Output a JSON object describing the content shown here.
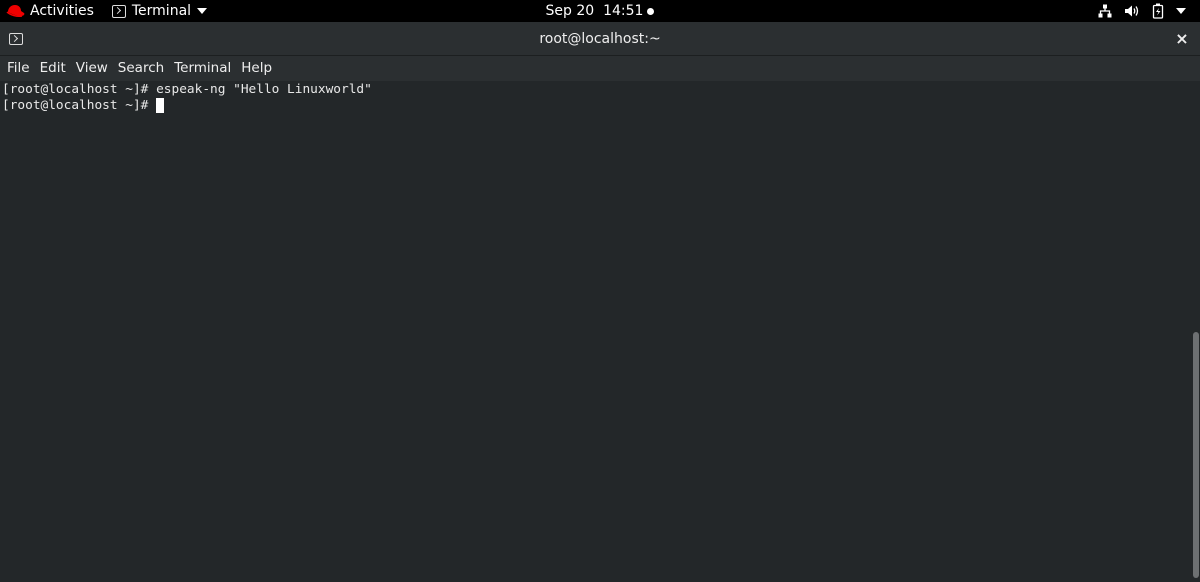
{
  "topbar": {
    "activities": "Activities",
    "app_menu": "Terminal",
    "clock": "Sep 20  14:51"
  },
  "window": {
    "title": "root@localhost:~",
    "close": "×"
  },
  "menu": [
    "File",
    "Edit",
    "View",
    "Search",
    "Terminal",
    "Help"
  ],
  "terminal": {
    "lines": [
      "[root@localhost ~]# espeak-ng \"Hello Linuxworld\"",
      "[root@localhost ~]# "
    ]
  },
  "colors": {
    "background": "#232729",
    "chrome": "#2b2f31",
    "accent_red": "#ee0000"
  }
}
